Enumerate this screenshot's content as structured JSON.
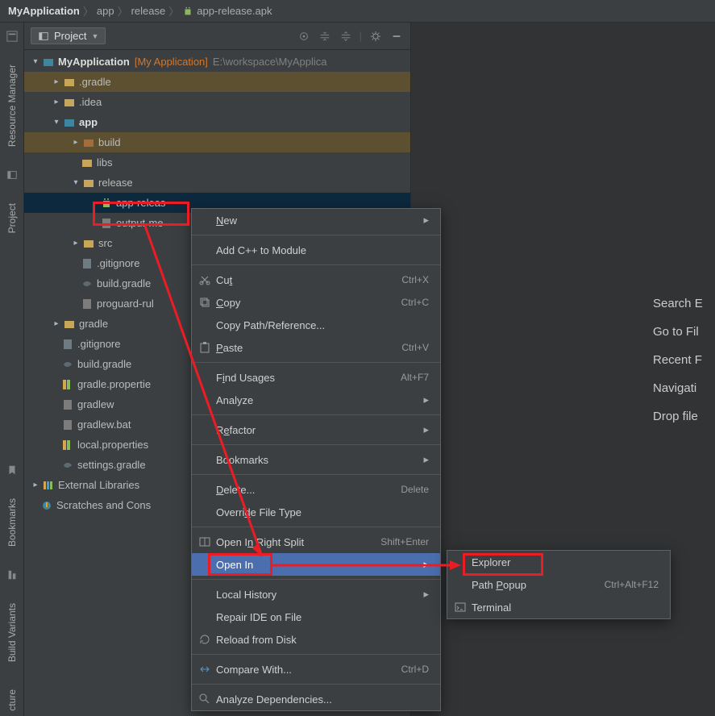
{
  "breadcrumbs": {
    "seg1": "MyApplication",
    "seg2": "app",
    "seg3": "release",
    "seg4": "app-release.apk"
  },
  "panel": {
    "viewmode": "Project"
  },
  "tree": {
    "root_name": "MyApplication",
    "root_hint": "[My Application]",
    "root_path": "E:\\workspace\\MyApplica",
    "gradle_dir": ".gradle",
    "idea_dir": ".idea",
    "app": "app",
    "build": "build",
    "libs": "libs",
    "release": "release",
    "apk": "app-releas",
    "output_meta": "output-me",
    "src": "src",
    "gitignore1": ".gitignore",
    "build_gradle1": "build.gradle",
    "proguard": "proguard-rul",
    "gradle_dir2": "gradle",
    "gitignore2": ".gitignore",
    "build_gradle2": "build.gradle",
    "gradle_props": "gradle.propertie",
    "gradlew": "gradlew",
    "gradlew_bat": "gradlew.bat",
    "local_props": "local.properties",
    "settings_gradle": "settings.gradle",
    "ext_libs": "External Libraries",
    "scratches": "Scratches and Cons"
  },
  "editor_quick": {
    "search": "Search E",
    "goto": "Go to Fil",
    "recent": "Recent F",
    "nav": "Navigati",
    "drop": "Drop file"
  },
  "menu": {
    "new": "New",
    "addcpp": "Add C++ to Module",
    "cut": "Cut",
    "cut_k": "Ctrl+X",
    "copy": "Copy",
    "copy_k": "Ctrl+C",
    "copypath": "Copy Path/Reference...",
    "paste": "Paste",
    "paste_k": "Ctrl+V",
    "findusages": "Find Usages",
    "findusages_k": "Alt+F7",
    "analyze": "Analyze",
    "refactor": "Refactor",
    "bookmarks": "Bookmarks",
    "delete": "Delete...",
    "delete_k": "Delete",
    "override": "Override File Type",
    "open_split": "Open In Right Split",
    "open_split_k": "Shift+Enter",
    "open_in": "Open In",
    "local_history": "Local History",
    "repair": "Repair IDE on File",
    "reload": "Reload from Disk",
    "compare": "Compare With...",
    "compare_k": "Ctrl+D",
    "analyze_deps": "Analyze Dependencies..."
  },
  "submenu": {
    "explorer": "Explorer",
    "path_popup": "Path Popup",
    "path_popup_k": "Ctrl+Alt+F12",
    "terminal": "Terminal"
  },
  "sidelabels": {
    "resmgr": "Resource Manager",
    "project": "Project",
    "bookmarks": "Bookmarks",
    "build_variants": "Build Variants",
    "structure": "cture"
  }
}
